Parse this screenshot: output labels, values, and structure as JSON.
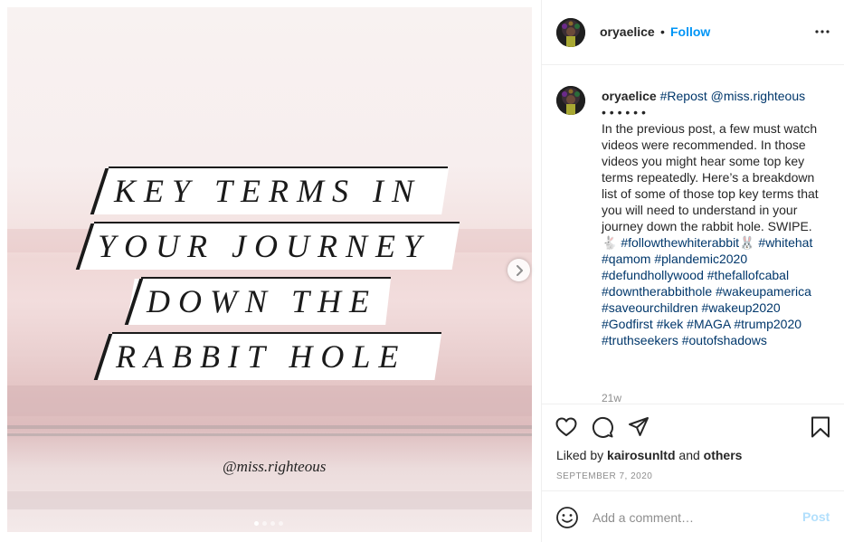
{
  "post_image": {
    "lines": [
      "KEY TERMS IN",
      "YOUR JOURNEY",
      "DOWN THE",
      "RABBIT HOLE"
    ],
    "credit": "@miss.righteous",
    "carousel_dots": 4,
    "active_dot": 0
  },
  "header": {
    "username": "oryaelice",
    "separator": "•",
    "follow_label": "Follow",
    "more_icon": "more-horizontal-icon"
  },
  "caption": {
    "username": "oryaelice",
    "repost_tag": "#Repost",
    "mention": "@miss.righteous",
    "bullets": "• • • • • •",
    "body": "In the previous post, a few must watch videos were recommended. In those videos you might hear some top key terms repeatedly. Here’s a breakdown list of some of those top key terms that you will need to understand in your journey down the rabbit hole. SWIPE. 🐇",
    "hashtags": [
      "#followthewhiterabbit🐰",
      "#whitehat",
      "#qamom",
      "#plandemic2020",
      "#defundhollywood",
      "#thefallofcabal",
      "#downtherabbithole",
      "#wakeupamerica",
      "#saveourchildren",
      "#wakeup2020",
      "#Godfirst",
      "#kek",
      "#MAGA",
      "#trump2020",
      "#truthseekers",
      "#outofshadows"
    ],
    "timestamp": "21w"
  },
  "actions": {
    "liked_prefix": "Liked by",
    "liked_user": "kairosunltd",
    "liked_and": "and",
    "liked_others": "others",
    "date": "SEPTEMBER 7, 2020"
  },
  "comment": {
    "placeholder": "Add a comment…",
    "post_label": "Post"
  },
  "colors": {
    "accent": "#0095f6",
    "hashtag": "#00376b",
    "post_disabled": "#b2dffc"
  }
}
